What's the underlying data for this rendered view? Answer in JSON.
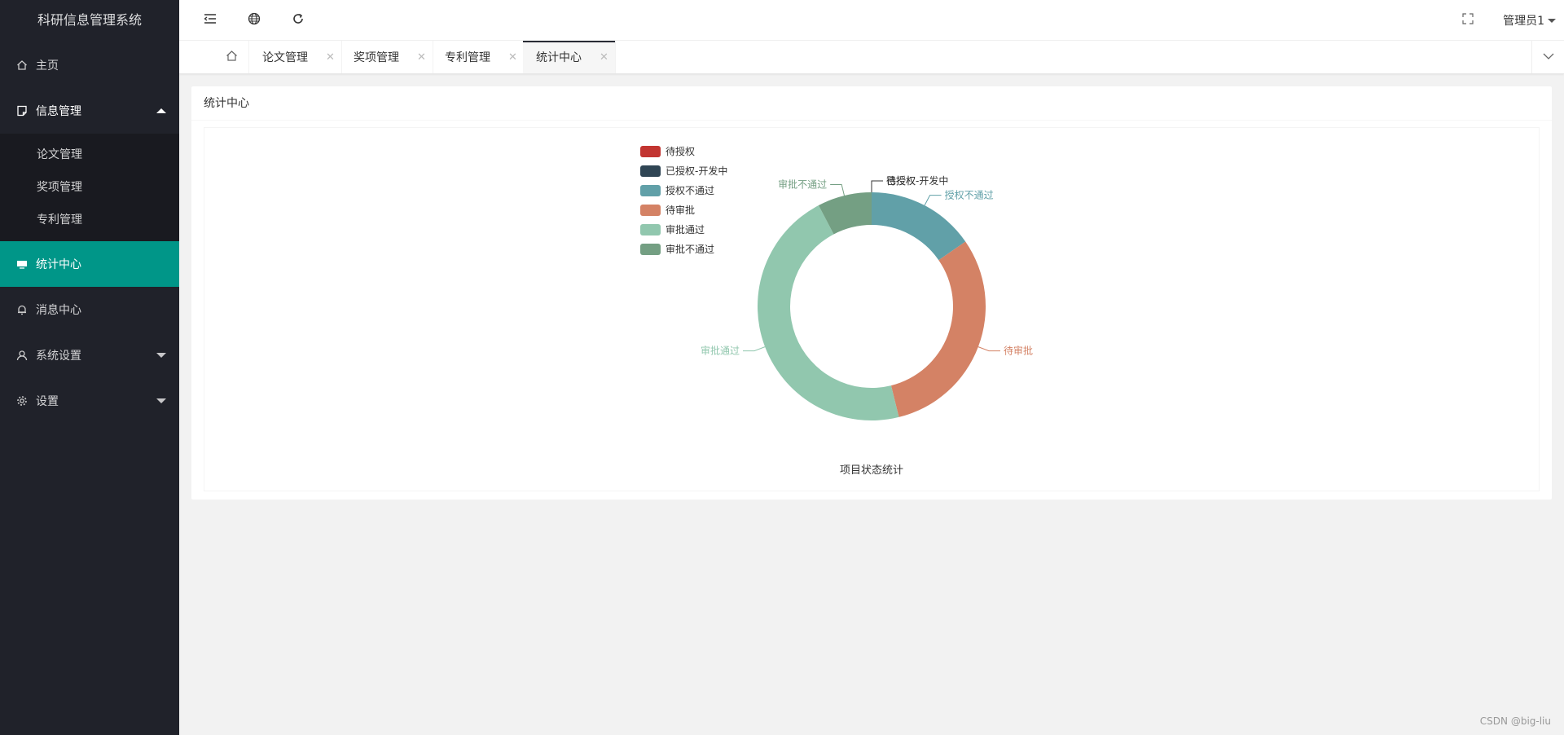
{
  "app": {
    "title": "科研信息管理系统"
  },
  "sidebar": {
    "items": [
      {
        "label": "主页",
        "icon": "home-icon"
      },
      {
        "label": "信息管理",
        "icon": "note-icon",
        "open": true,
        "children": [
          "论文管理",
          "奖项管理",
          "专利管理"
        ]
      },
      {
        "label": "统计中心",
        "icon": "chart-icon",
        "active": true
      },
      {
        "label": "消息中心",
        "icon": "bell-icon"
      },
      {
        "label": "系统设置",
        "icon": "user-icon"
      },
      {
        "label": "设置",
        "icon": "gear-icon"
      }
    ]
  },
  "header": {
    "user": "管理员1",
    "buttons": [
      "menu-fold-icon",
      "globe-icon",
      "refresh-icon",
      "fullscreen-icon"
    ]
  },
  "tabs": {
    "items": [
      {
        "label": "论文管理"
      },
      {
        "label": "奖项管理"
      },
      {
        "label": "专利管理"
      },
      {
        "label": "统计中心",
        "active": true
      }
    ]
  },
  "card": {
    "title": "统计中心"
  },
  "chart_data": {
    "type": "pie",
    "donut": true,
    "title": "项目状态统计",
    "legend_position": "top-left",
    "colors": {
      "待授权": "#c23531",
      "已授权-开发中": "#2f4554",
      "授权不通过": "#61a0a8",
      "待审批": "#d48265",
      "审批通过": "#91c7ae",
      "审批不通过": "#749f83"
    },
    "categories": [
      "待授权",
      "已授权-开发中",
      "授权不通过",
      "待审批",
      "审批通过",
      "审批不通过"
    ],
    "values": [
      0,
      0,
      1,
      2,
      3,
      0.5
    ],
    "slice_labels": [
      "待授权",
      "已授权-开发中",
      "授权不通过",
      "待审批",
      "审批通过",
      "审批不通过"
    ]
  },
  "watermark": "CSDN @big-liu"
}
